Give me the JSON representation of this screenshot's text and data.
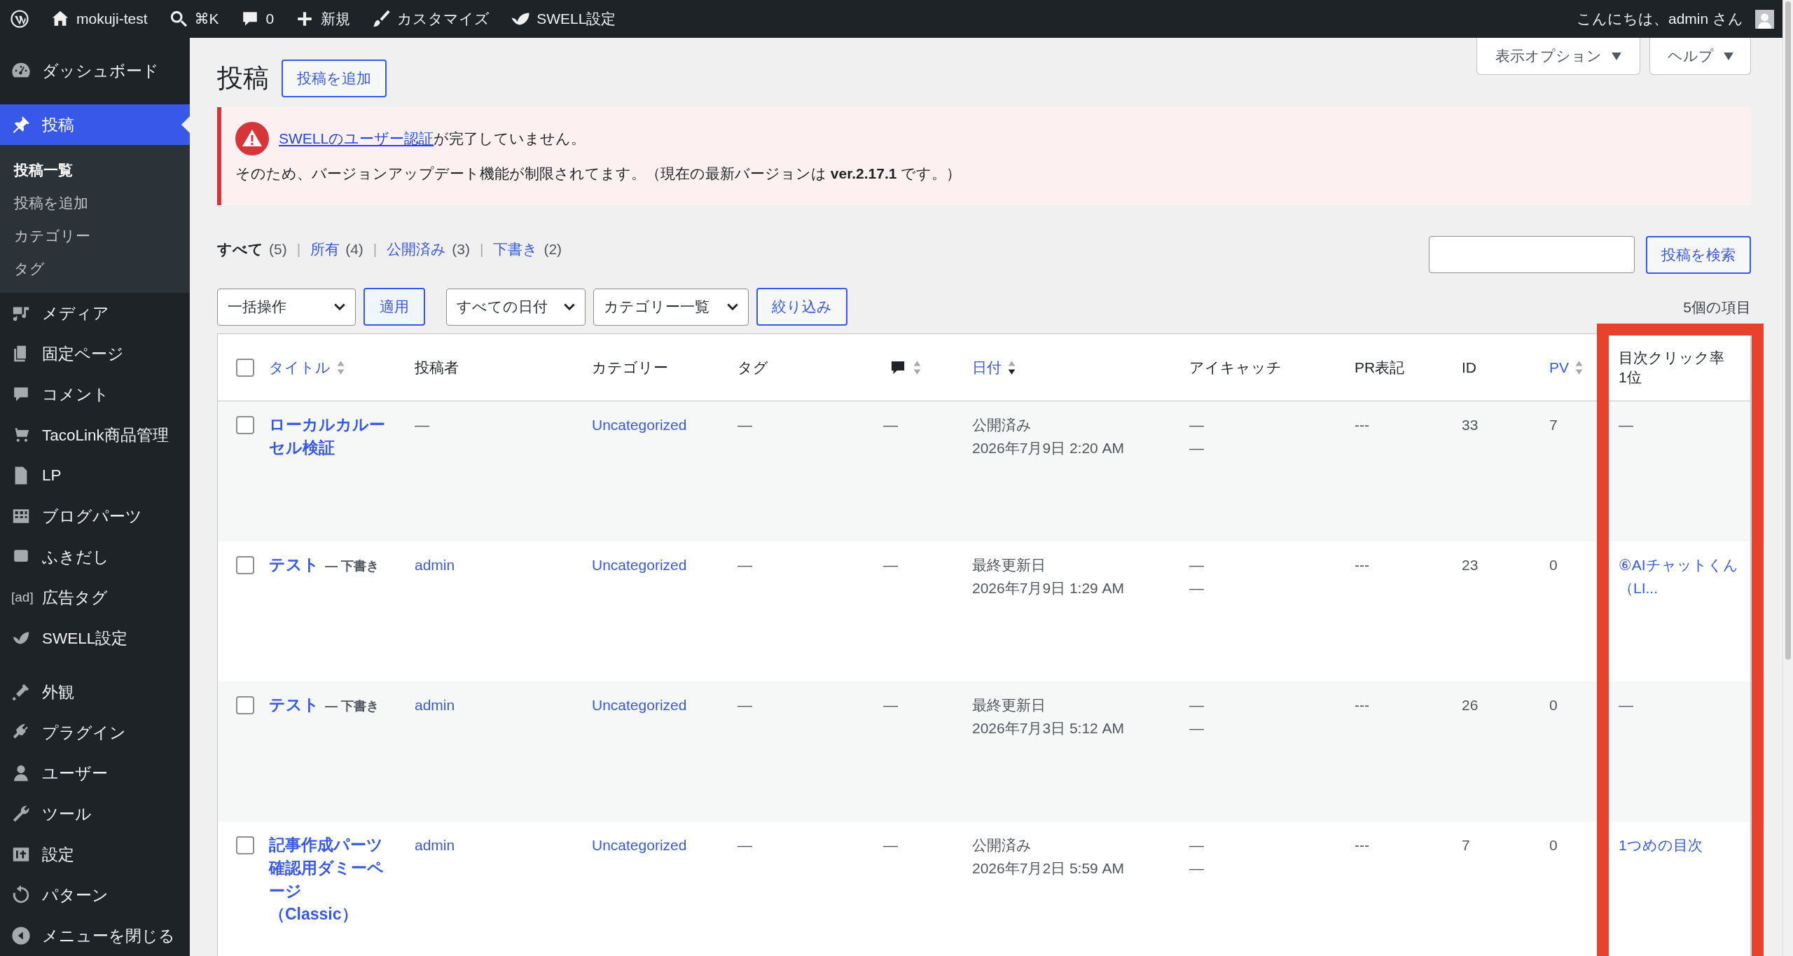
{
  "admin_bar": {
    "items": [
      {
        "kind": "logo"
      },
      {
        "kind": "home",
        "label": "mokuji-test"
      },
      {
        "kind": "search",
        "label": "⌘K"
      },
      {
        "kind": "comments",
        "label": "0"
      },
      {
        "kind": "new",
        "label": "新規"
      },
      {
        "kind": "customize",
        "label": "カスタマイズ"
      },
      {
        "kind": "swell",
        "label": "SWELL設定"
      }
    ],
    "greeting": "こんにちは、admin さん"
  },
  "sidebar": {
    "groups": [
      {
        "items": [
          {
            "label": "ダッシュボード",
            "selected": false
          }
        ]
      },
      {
        "items": [
          {
            "label": "投稿",
            "selected": true,
            "children": [
              {
                "label": "投稿一覧",
                "selected": true
              },
              {
                "label": "投稿を追加",
                "selected": false
              },
              {
                "label": "カテゴリー",
                "selected": false
              },
              {
                "label": "タグ",
                "selected": false
              }
            ]
          },
          {
            "label": "メディア",
            "selected": false
          },
          {
            "label": "固定ページ",
            "selected": false
          },
          {
            "label": "コメント",
            "selected": false
          },
          {
            "label": "TacoLink商品管理",
            "selected": false
          },
          {
            "label": "LP",
            "selected": false
          },
          {
            "label": "ブログパーツ",
            "selected": false
          },
          {
            "label": "ふきだし",
            "selected": false
          },
          {
            "label": "広告タグ",
            "icon_text": "[ad]",
            "selected": false
          },
          {
            "label": "SWELL設定",
            "selected": false
          }
        ]
      },
      {
        "items": [
          {
            "label": "外観",
            "selected": false
          },
          {
            "label": "プラグイン",
            "selected": false
          },
          {
            "label": "ユーザー",
            "selected": false
          },
          {
            "label": "ツール",
            "selected": false
          },
          {
            "label": "設定",
            "selected": false
          },
          {
            "label": "パターン",
            "selected": false
          },
          {
            "label": "メニューを閉じる",
            "selected": false
          }
        ]
      }
    ]
  },
  "page": {
    "title": "投稿",
    "add_button": "投稿を追加",
    "screen_options": "表示オプション",
    "help": "ヘルプ"
  },
  "notice": {
    "link": "SWELLのユーザー認証",
    "line1": "が完了していません。",
    "line2": "そのため、バージョンアップデート機能が制限されてます。（現在の最新バージョンは **ver.2.17.1** です。）"
  },
  "views": [
    {
      "label": "すべて",
      "count": "(5)",
      "selected": true,
      "separator": "|"
    },
    {
      "label": "所有",
      "count": "(4)",
      "selected": false,
      "separator": "|"
    },
    {
      "label": "公開済み",
      "count": "(3)",
      "selected": false,
      "separator": "|"
    },
    {
      "label": "下書き",
      "count": "(2)",
      "selected": false
    }
  ],
  "search": {
    "button": "投稿を検索"
  },
  "filters": {
    "bulk_action": "一括操作",
    "apply": "適用",
    "date": "すべての日付",
    "category": "カテゴリー一覧",
    "filter": "絞り込み",
    "count": "5個の項目"
  },
  "table": {
    "select_all": {
      "checked": false
    },
    "columns": [
      {
        "kind": "text",
        "label": "タイトル",
        "sortable": true,
        "sorted_desc": false
      },
      {
        "kind": "text",
        "label": "投稿者",
        "sortable": false
      },
      {
        "kind": "text",
        "label": "カテゴリー",
        "sortable": false
      },
      {
        "kind": "text",
        "label": "タグ",
        "sortable": false
      },
      {
        "kind": "comments",
        "sortable": true,
        "sorted_desc": false
      },
      {
        "kind": "text",
        "label": "日付",
        "sortable": true,
        "sorted_desc": true
      },
      {
        "kind": "text",
        "label": "アイキャッチ",
        "sortable": false
      },
      {
        "kind": "text",
        "label": "PR表記",
        "sortable": false
      },
      {
        "kind": "text",
        "label": "ID",
        "sortable": false
      },
      {
        "kind": "text",
        "label": "PV",
        "sortable": true,
        "sorted_desc": false
      },
      {
        "kind": "text",
        "label": "目次クリック率1位",
        "sortable": false
      }
    ],
    "rows": [
      {
        "checked": false,
        "title": "ローカルカルーセル検証",
        "author": "—",
        "author_link": false,
        "category": "Uncategorized",
        "tag": "—",
        "comments": "—",
        "date_status": "公開済み",
        "date": "2026年7月9日 2:20 AM",
        "eyecatch": [
          "—",
          "—"
        ],
        "pr": "---",
        "id": "33",
        "pv": "7",
        "toc": "—",
        "toc_link": false
      },
      {
        "checked": false,
        "title": "テスト",
        "state": "— 下書き",
        "author": "admin",
        "author_link": true,
        "category": "Uncategorized",
        "tag": "—",
        "comments": "—",
        "date_status": "最終更新日",
        "date": "2026年7月9日 1:29 AM",
        "eyecatch": [
          "—",
          "—"
        ],
        "pr": "---",
        "id": "23",
        "pv": "0",
        "toc": "⑥AIチャットくん（LI...",
        "toc_link": true
      },
      {
        "checked": false,
        "title": "テスト",
        "state": "— 下書き",
        "author": "admin",
        "author_link": true,
        "category": "Uncategorized",
        "tag": "—",
        "comments": "—",
        "date_status": "最終更新日",
        "date": "2026年7月3日 5:12 AM",
        "eyecatch": [
          "—",
          "—"
        ],
        "pr": "---",
        "id": "26",
        "pv": "0",
        "toc": "—",
        "toc_link": false
      },
      {
        "checked": false,
        "title": "記事作成パーツ確認用ダミーページ（Classic）",
        "author": "admin",
        "author_link": true,
        "category": "Uncategorized",
        "tag": "—",
        "comments": "—",
        "date_status": "公開済み",
        "date": "2026年7月2日 5:59 AM",
        "eyecatch": [
          "—",
          "—"
        ],
        "pr": "---",
        "id": "7",
        "pv": "0",
        "toc": "1つめの目次",
        "toc_link": true
      }
    ]
  }
}
